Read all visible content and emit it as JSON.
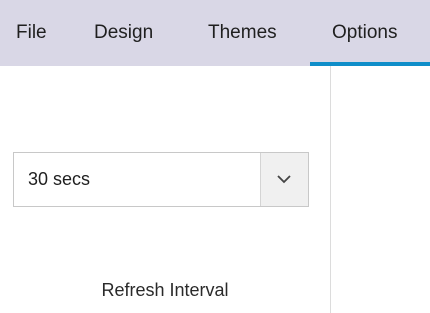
{
  "menubar": {
    "tabs": [
      {
        "label": "File"
      },
      {
        "label": "Design"
      },
      {
        "label": "Themes"
      },
      {
        "label": "Options",
        "active": true
      }
    ]
  },
  "options_panel": {
    "refresh_interval": {
      "selected": "30 secs",
      "group_label": "Refresh Interval"
    }
  },
  "colors": {
    "menubar_bg": "#d9d7e6",
    "active_tab_accent": "#0f8ec9"
  },
  "icons": {
    "dropdown": "chevron-down-icon"
  }
}
